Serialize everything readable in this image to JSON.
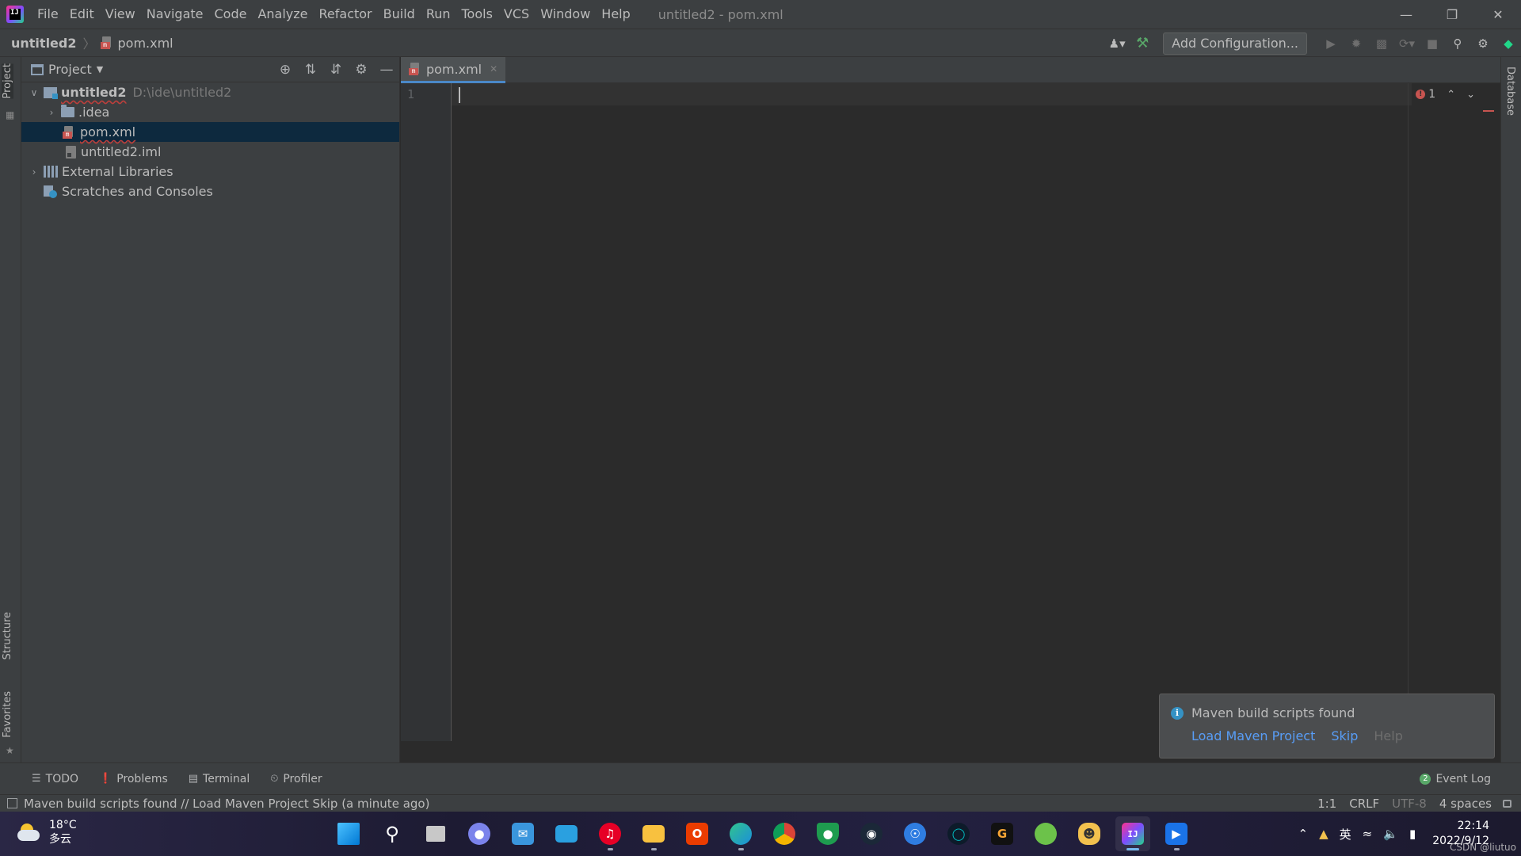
{
  "title_bar": {
    "logo_text": "IJ",
    "menu": [
      "File",
      "Edit",
      "View",
      "Navigate",
      "Code",
      "Analyze",
      "Refactor",
      "Build",
      "Run",
      "Tools",
      "VCS",
      "Window",
      "Help"
    ],
    "window_title": "untitled2 - pom.xml"
  },
  "navbar": {
    "project": "untitled2",
    "file": "pom.xml",
    "add_configuration": "Add Configuration..."
  },
  "left_stripe": {
    "project_tab": "Project",
    "structure_tab": "Structure",
    "favorites_tab": "Favorites"
  },
  "right_stripe": {
    "database_tab": "Database"
  },
  "project_panel": {
    "title": "Project",
    "tree": {
      "root_name": "untitled2",
      "root_path": "D:\\ide\\untitled2",
      "idea": ".idea",
      "pom": "pom.xml",
      "iml": "untitled2.iml",
      "external_libraries": "External Libraries",
      "scratches": "Scratches and Consoles"
    }
  },
  "editor": {
    "tab_label": "pom.xml",
    "line_number": "1",
    "error_count": "1"
  },
  "notification": {
    "title": "Maven build scripts found",
    "load": "Load Maven Project",
    "skip": "Skip",
    "help": "Help"
  },
  "bottom_bar": {
    "todo": "TODO",
    "problems": "Problems",
    "terminal": "Terminal",
    "profiler": "Profiler",
    "event_log_count": "2",
    "event_log": "Event Log"
  },
  "status_bar": {
    "message": "Maven build scripts found // Load Maven Project   Skip (a minute ago)",
    "position": "1:1",
    "line_sep": "CRLF",
    "encoding": "UTF-8",
    "indent": "4 spaces"
  },
  "taskbar": {
    "temperature": "18°C",
    "weather": "多云",
    "ime": "英",
    "time": "22:14",
    "date": "2022/9/12",
    "watermark": "CSDN @liutuo"
  },
  "colors": {
    "accent": "#4a88c7",
    "error": "#c75450",
    "link": "#589df6",
    "selection": "#0d293e"
  }
}
